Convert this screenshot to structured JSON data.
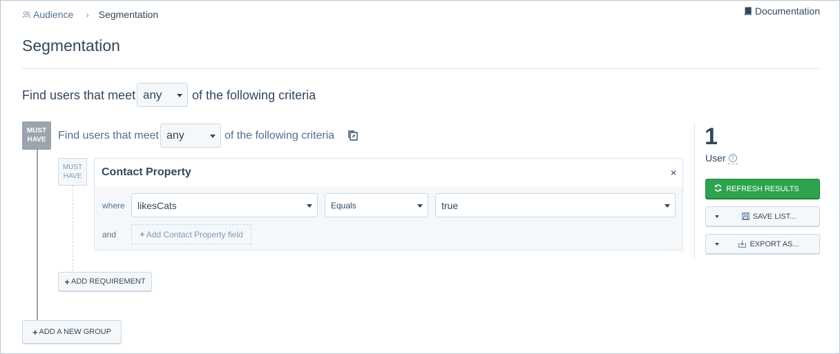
{
  "breadcrumb": {
    "parent": "Audience",
    "current": "Segmentation"
  },
  "header": {
    "documentation_label": "Documentation"
  },
  "page": {
    "title": "Segmentation"
  },
  "criteria": {
    "prefix": "Find users that meet",
    "mode": "any",
    "suffix": "of the following criteria"
  },
  "group": {
    "badge": [
      "MUST",
      "HAVE"
    ],
    "prefix": "Find users that meet",
    "mode": "any",
    "suffix": "of the following criteria",
    "requirement": {
      "badge": [
        "MUST",
        "HAVE"
      ],
      "card_title": "Contact Property",
      "close_label": "×",
      "where_label": "where",
      "property": "likesCats",
      "operator": "Equals",
      "value": "true",
      "and_label": "and",
      "add_field_label": "Add Contact Property field"
    },
    "add_requirement_label": "ADD REQUIREMENT"
  },
  "add_group_label": "ADD A NEW GROUP",
  "results": {
    "count": "1",
    "unit_label": "User",
    "help_glyph": "?",
    "refresh_label": "REFRESH RESULTS",
    "save_label": "SAVE LIST...",
    "export_label": "EXPORT AS..."
  },
  "colors": {
    "primary_green": "#2ea44f",
    "badge_gray": "#99a4ad",
    "text": "#33475b"
  }
}
